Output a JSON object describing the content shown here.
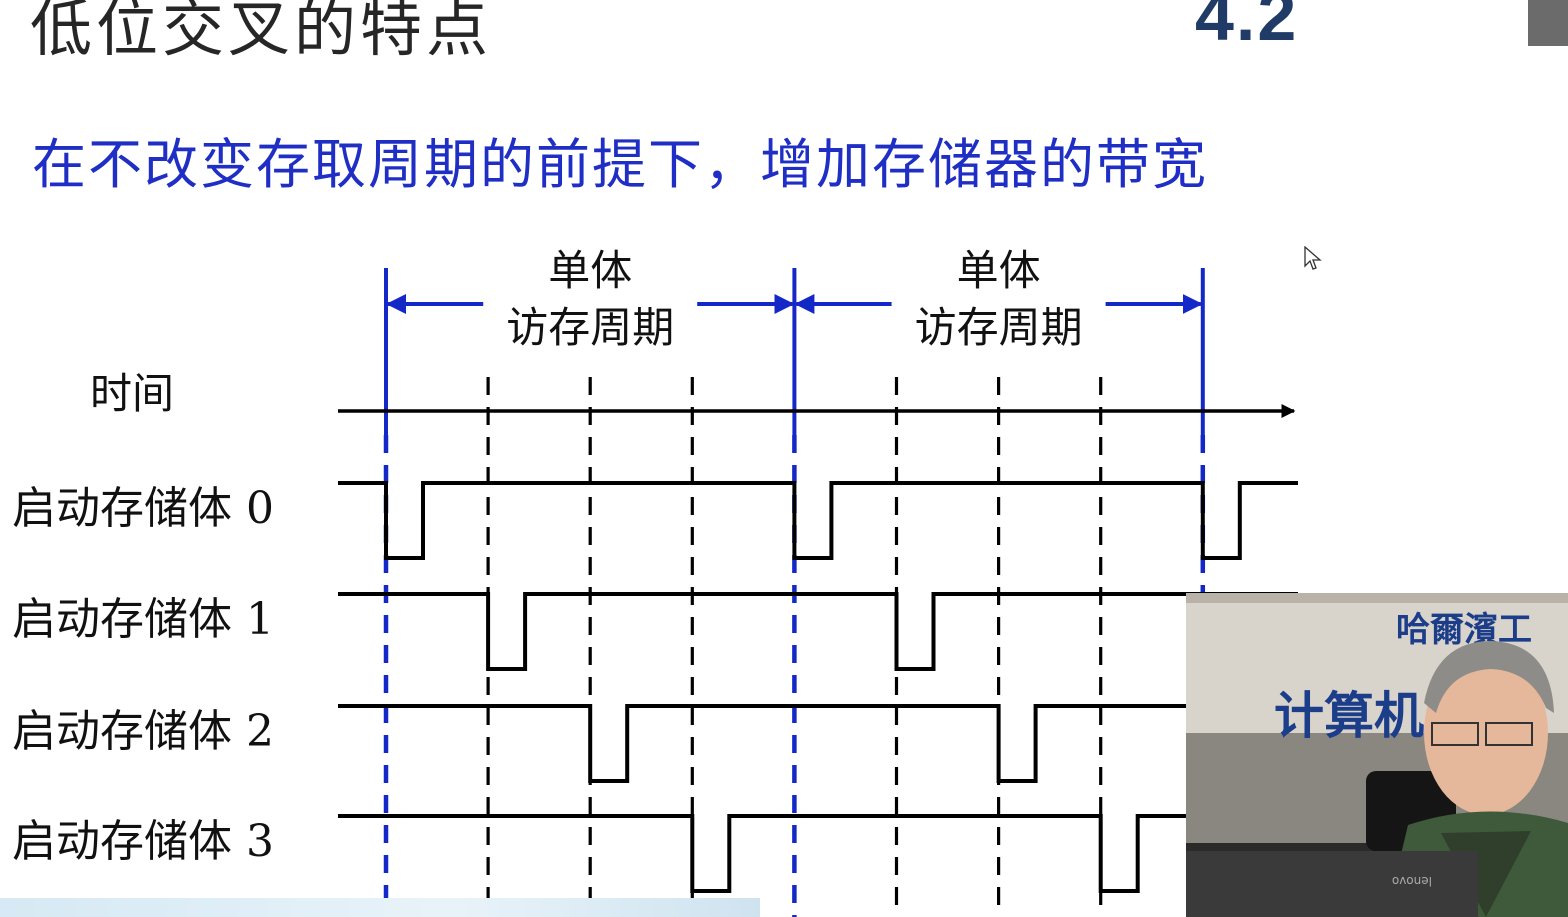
{
  "header": {
    "title": "低位交叉的特点",
    "section_number": "4.2"
  },
  "subtitle": "在不改变存取周期的前提下，增加存储器的带宽",
  "diagram": {
    "period_labels": [
      {
        "line1": "单体",
        "line2": "访存周期"
      },
      {
        "line1": "单体",
        "line2": "访存周期"
      }
    ],
    "time_label": "时间",
    "banks": [
      {
        "label": "启动存储体 0",
        "pulse_slots": [
          0,
          4,
          8
        ]
      },
      {
        "label": "启动存储体 1",
        "pulse_slots": [
          1,
          5
        ]
      },
      {
        "label": "启动存储体 2",
        "pulse_slots": [
          2,
          6
        ]
      },
      {
        "label": "启动存储体 3",
        "pulse_slots": [
          3,
          7
        ]
      }
    ],
    "colors": {
      "period_marker": "#1428c8",
      "signal": "#000000",
      "subtitle": "#1f2ec4",
      "section_number": "#1f3b66"
    }
  },
  "video_overlay": {
    "wall_sign_top": "哈爾濱工",
    "wall_sign_bottom": "计算机",
    "laptop_brand": "lenovo",
    "icon": "lecturer-video-icon"
  },
  "cursor": {
    "icon": "mouse-pointer-icon"
  }
}
